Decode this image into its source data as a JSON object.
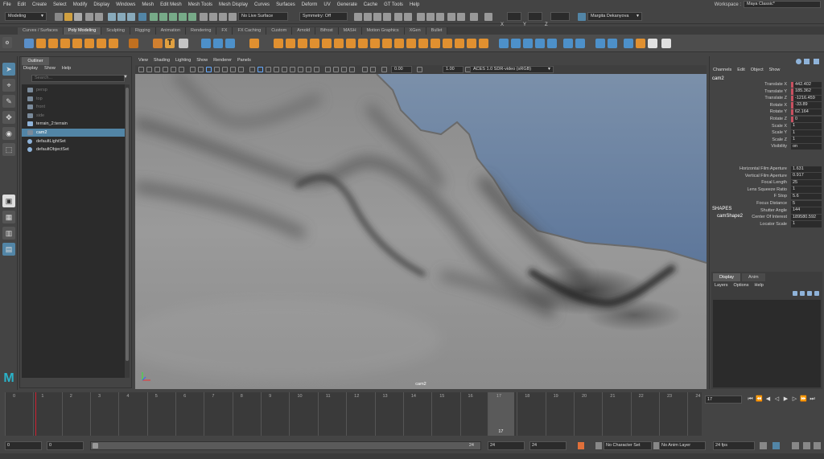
{
  "menubar": {
    "items": [
      "File",
      "Edit",
      "Create",
      "Select",
      "Modify",
      "Display",
      "Windows",
      "Mesh",
      "Edit Mesh",
      "Mesh Tools",
      "Mesh Display",
      "Curves",
      "Surfaces",
      "Deform",
      "UV",
      "Generate",
      "Cache",
      "GT Tools",
      "Help"
    ],
    "workspace_label": "Workspace :",
    "workspace_value": "Maya Classic*"
  },
  "statusline": {
    "mode": "Modeling",
    "live_surface": "No Live Surface",
    "symmetry": "Symmetry: Off",
    "x_label": "X",
    "y_label": "Y",
    "z_label": "Z",
    "user": "Margita Dekanyova"
  },
  "shelf_tabs": [
    "Curves / Surfaces",
    "Poly Modeling",
    "Sculpting",
    "Rigging",
    "Animation",
    "Rendering",
    "FX",
    "FX Caching",
    "Custom",
    "Arnold",
    "Bifrost",
    "MASH",
    "Motion Graphics",
    "XGen",
    "Bullet"
  ],
  "active_shelf_tab": "Poly Modeling",
  "outliner": {
    "title": "Outliner",
    "menu": [
      "Display",
      "Show",
      "Help"
    ],
    "search_placeholder": "Search...",
    "items": [
      {
        "label": "persp",
        "dim": true,
        "icon": "camera-icon"
      },
      {
        "label": "top",
        "dim": true,
        "icon": "camera-icon"
      },
      {
        "label": "front",
        "dim": true,
        "icon": "camera-icon"
      },
      {
        "label": "side",
        "dim": true,
        "icon": "camera-icon"
      },
      {
        "label": "terrain_2:terrain",
        "dim": false,
        "icon": "group-icon"
      },
      {
        "label": "cam2",
        "dim": false,
        "icon": "camera-icon",
        "selected": true
      },
      {
        "label": "defaultLightSet",
        "dim": false,
        "icon": "set-icon"
      },
      {
        "label": "defaultObjectSet",
        "dim": false,
        "icon": "set-icon"
      }
    ]
  },
  "viewport": {
    "menu": [
      "View",
      "Shading",
      "Lighting",
      "Show",
      "Renderer",
      "Panels"
    ],
    "exposure": "0.00",
    "gamma": "1.00",
    "color_space": "ACES 1.0 SDR-video (sRGB)",
    "camera_label": "cam2"
  },
  "channel_box": {
    "menu": [
      "Channels",
      "Edit",
      "Object",
      "Show"
    ],
    "object_name": "cam2",
    "transform_attrs": [
      {
        "name": "Translate X",
        "value": "442.402",
        "keyed": true
      },
      {
        "name": "Translate Y",
        "value": "185.362",
        "keyed": true
      },
      {
        "name": "Translate Z",
        "value": "-1216.459",
        "keyed": true
      },
      {
        "name": "Rotate X",
        "value": "-33.89",
        "keyed": true
      },
      {
        "name": "Rotate Y",
        "value": "62.164",
        "keyed": true
      },
      {
        "name": "Rotate Z",
        "value": "0",
        "keyed": true
      },
      {
        "name": "Scale X",
        "value": "1",
        "keyed": false
      },
      {
        "name": "Scale Y",
        "value": "1",
        "keyed": false
      },
      {
        "name": "Scale Z",
        "value": "1",
        "keyed": false
      },
      {
        "name": "Visibility",
        "value": "on",
        "keyed": false
      }
    ],
    "shapes_header": "SHAPES",
    "shape_name": "camShape2",
    "shape_attrs": [
      {
        "name": "Horizontal Film Aperture",
        "value": "1.631"
      },
      {
        "name": "Vertical Film Aperture",
        "value": "0.917"
      },
      {
        "name": "Focal Length",
        "value": "25"
      },
      {
        "name": "Lens Squeeze Ratio",
        "value": "1"
      },
      {
        "name": "F Stop",
        "value": "5.6"
      },
      {
        "name": "Focus Distance",
        "value": "5"
      },
      {
        "name": "Shutter Angle",
        "value": "144"
      },
      {
        "name": "Center Of Interest",
        "value": "189580.592"
      },
      {
        "name": "Locator Scale",
        "value": "1"
      }
    ]
  },
  "layer_editor": {
    "tabs": [
      "Display",
      "Anim"
    ],
    "menu": [
      "Layers",
      "Options",
      "Help"
    ]
  },
  "timeline": {
    "frames": [
      "0",
      "1",
      "2",
      "3",
      "4",
      "5",
      "6",
      "7",
      "8",
      "9",
      "10",
      "11",
      "12",
      "13",
      "14",
      "15",
      "16",
      "17",
      "18",
      "19",
      "20",
      "21",
      "22",
      "23",
      "24"
    ],
    "current_frame": "17",
    "current_frame_field": "17"
  },
  "range": {
    "start": "0",
    "playback_start": "0",
    "playback_end": "24",
    "end": "24",
    "end2": "24",
    "character_set": "No Character Set",
    "anim_layer": "No Anim Layer",
    "fps": "24 fps"
  }
}
